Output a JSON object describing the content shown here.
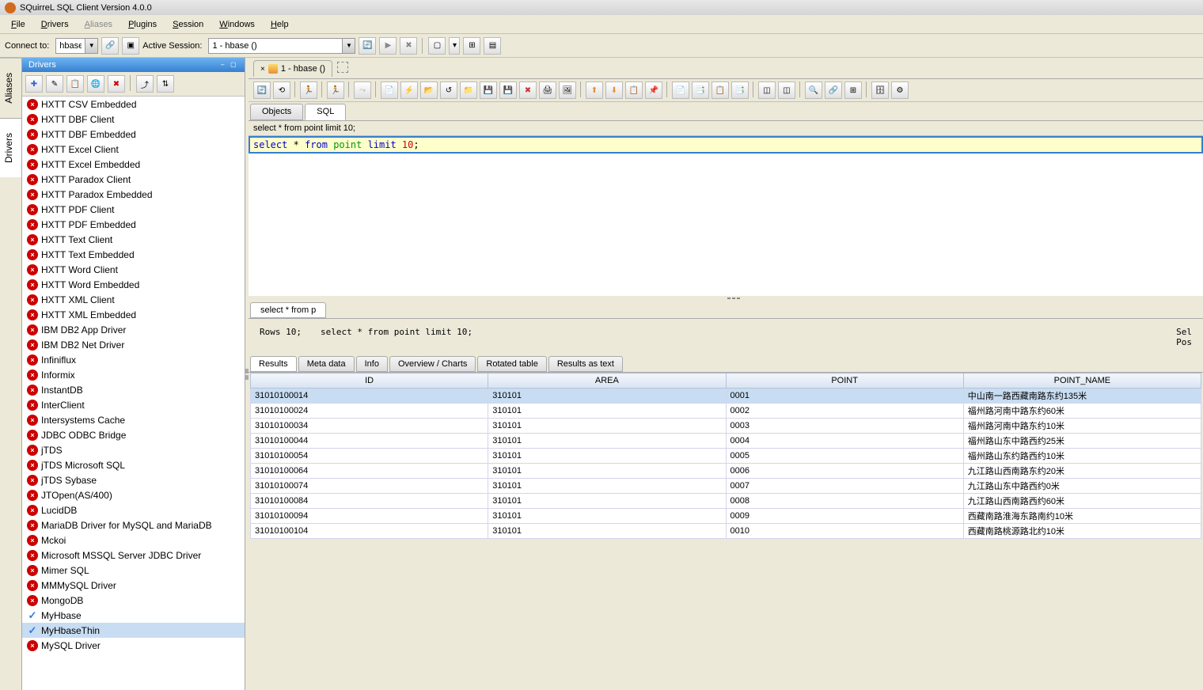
{
  "titlebar": {
    "text": "SQuirreL SQL Client Version 4.0.0"
  },
  "menubar": {
    "file": "File",
    "drivers": "Drivers",
    "aliases": "Aliases",
    "plugins": "Plugins",
    "session": "Session",
    "windows": "Windows",
    "help": "Help"
  },
  "toolbar": {
    "connect_label": "Connect to:",
    "connect_value": "hbase",
    "session_label": "Active Session:",
    "session_value": "1 - hbase ()"
  },
  "vert_tabs": {
    "aliases": "Aliases",
    "drivers": "Drivers"
  },
  "sidebar": {
    "title": "Drivers",
    "drivers": [
      {
        "name": "HXTT CSV Embedded",
        "ok": false
      },
      {
        "name": "HXTT DBF Client",
        "ok": false
      },
      {
        "name": "HXTT DBF Embedded",
        "ok": false
      },
      {
        "name": "HXTT Excel Client",
        "ok": false
      },
      {
        "name": "HXTT Excel Embedded",
        "ok": false
      },
      {
        "name": "HXTT Paradox Client",
        "ok": false
      },
      {
        "name": "HXTT Paradox Embedded",
        "ok": false
      },
      {
        "name": "HXTT PDF Client",
        "ok": false
      },
      {
        "name": "HXTT PDF Embedded",
        "ok": false
      },
      {
        "name": "HXTT Text Client",
        "ok": false
      },
      {
        "name": "HXTT Text Embedded",
        "ok": false
      },
      {
        "name": "HXTT Word Client",
        "ok": false
      },
      {
        "name": "HXTT Word Embedded",
        "ok": false
      },
      {
        "name": "HXTT XML Client",
        "ok": false
      },
      {
        "name": "HXTT XML Embedded",
        "ok": false
      },
      {
        "name": "IBM DB2 App Driver",
        "ok": false
      },
      {
        "name": "IBM DB2 Net Driver",
        "ok": false
      },
      {
        "name": "Infiniflux",
        "ok": false
      },
      {
        "name": "Informix",
        "ok": false
      },
      {
        "name": "InstantDB",
        "ok": false
      },
      {
        "name": "InterClient",
        "ok": false
      },
      {
        "name": "Intersystems Cache",
        "ok": false
      },
      {
        "name": "JDBC ODBC Bridge",
        "ok": false
      },
      {
        "name": "jTDS",
        "ok": false
      },
      {
        "name": "jTDS Microsoft SQL",
        "ok": false
      },
      {
        "name": "jTDS Sybase",
        "ok": false
      },
      {
        "name": "JTOpen(AS/400)",
        "ok": false
      },
      {
        "name": "LucidDB",
        "ok": false
      },
      {
        "name": "MariaDB Driver for MySQL and MariaDB",
        "ok": false
      },
      {
        "name": "Mckoi",
        "ok": false
      },
      {
        "name": "Microsoft MSSQL Server JDBC Driver",
        "ok": false
      },
      {
        "name": "Mimer SQL",
        "ok": false
      },
      {
        "name": "MMMySQL Driver",
        "ok": false
      },
      {
        "name": "MongoDB",
        "ok": false
      },
      {
        "name": "MyHbase",
        "ok": true
      },
      {
        "name": "MyHbaseThin",
        "ok": true,
        "selected": true
      },
      {
        "name": "MySQL Driver",
        "ok": false
      }
    ]
  },
  "session": {
    "tab_label": "1 - hbase ()",
    "objects_tab": "Objects",
    "sql_tab": "SQL",
    "history_sql": "select * from point limit 10;",
    "editor_sql": {
      "select": "select",
      "star": "*",
      "from": "from",
      "tbl": "point",
      "limit": "limit",
      "num": "10"
    }
  },
  "result": {
    "tab_label": "select * from p",
    "rows_label": "Rows 10;",
    "echo": "select * from point limit 10;",
    "right1": "Sel",
    "right2": "Pos",
    "subtabs": [
      "Results",
      "Meta data",
      "Info",
      "Overview / Charts",
      "Rotated table",
      "Results as text"
    ],
    "columns": [
      "ID",
      "AREA",
      "POINT",
      "POINT_NAME"
    ],
    "rows": [
      [
        "31010100014",
        "310101",
        "0001",
        "中山南一路西藏南路东约135米"
      ],
      [
        "31010100024",
        "310101",
        "0002",
        "福州路河南中路东约60米"
      ],
      [
        "31010100034",
        "310101",
        "0003",
        "福州路河南中路东约10米"
      ],
      [
        "31010100044",
        "310101",
        "0004",
        "福州路山东中路西约25米"
      ],
      [
        "31010100054",
        "310101",
        "0005",
        "福州路山东约路西约10米"
      ],
      [
        "31010100064",
        "310101",
        "0006",
        "九江路山西南路东约20米"
      ],
      [
        "31010100074",
        "310101",
        "0007",
        "九江路山东中路西约0米"
      ],
      [
        "31010100084",
        "310101",
        "0008",
        "九江路山西南路西约60米"
      ],
      [
        "31010100094",
        "310101",
        "0009",
        "西藏南路淮海东路南约10米"
      ],
      [
        "31010100104",
        "310101",
        "0010",
        "西藏南路桃源路北约10米"
      ]
    ]
  }
}
